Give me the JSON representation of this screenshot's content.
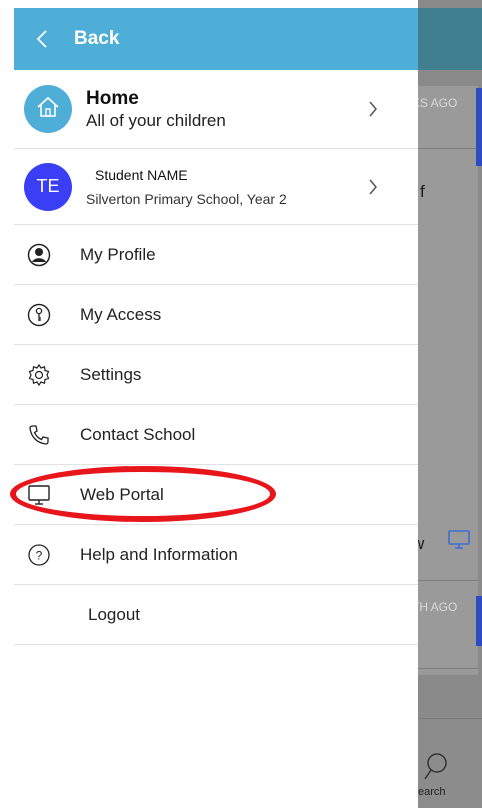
{
  "header": {
    "back_label": "Back"
  },
  "home": {
    "title": "Home",
    "subtitle": "All of your children"
  },
  "student": {
    "initials": "TE",
    "name": "Student NAME",
    "school": "Silverton Primary School, Year 2"
  },
  "menu": [
    {
      "label": "My Profile",
      "icon": "profile-icon"
    },
    {
      "label": "My Access",
      "icon": "key-icon"
    },
    {
      "label": "Settings",
      "icon": "gear-icon"
    },
    {
      "label": "Contact School",
      "icon": "phone-icon"
    },
    {
      "label": "Web Portal",
      "icon": "monitor-icon"
    },
    {
      "label": "Help and Information",
      "icon": "help-icon"
    },
    {
      "label": "Logout"
    }
  ],
  "background": {
    "text1": "KS AGO",
    "text2": "f",
    "text3": "w",
    "text4": "TH AGO",
    "search_label": "earch"
  },
  "colors": {
    "header": "#4faed8",
    "avatar_home": "#4faed8",
    "avatar_student": "#3a3ff5",
    "annotation": "#e8151b",
    "background_overlay": "#8a8a8a"
  }
}
